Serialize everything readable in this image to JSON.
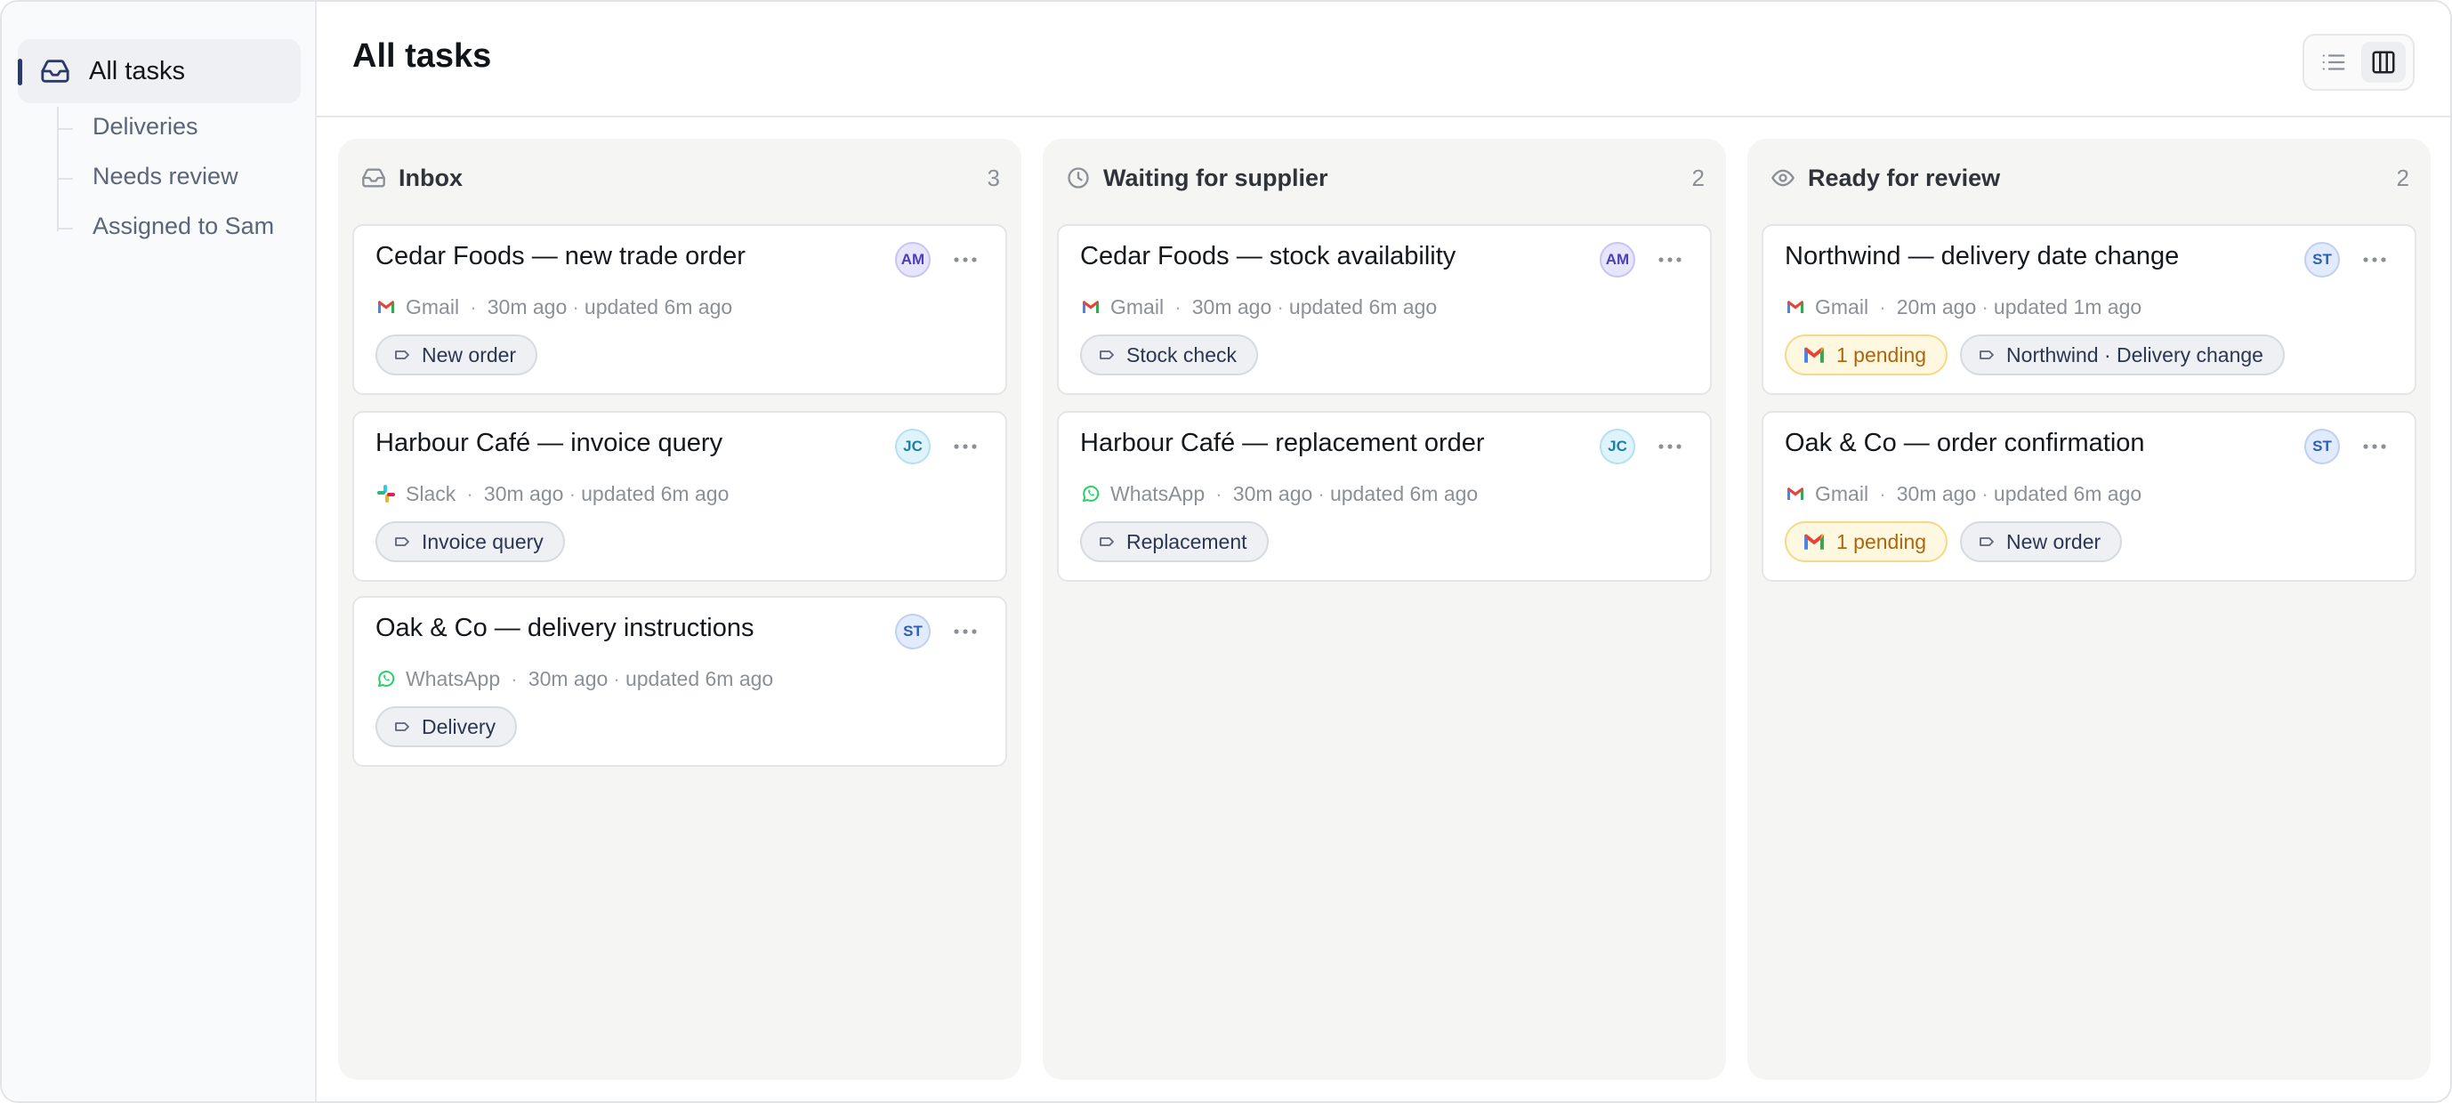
{
  "sidebar": {
    "active": {
      "label": "All tasks",
      "icon": "inbox-icon"
    },
    "sub_items": [
      {
        "label": "Deliveries"
      },
      {
        "label": "Needs review"
      },
      {
        "label": "Assigned to Sam"
      }
    ]
  },
  "header": {
    "title": "All tasks",
    "view_toggle": {
      "options": [
        "list-view-icon",
        "board-view-icon"
      ],
      "selected": "board-view-icon"
    }
  },
  "columns": [
    {
      "title": "Inbox",
      "count": "3",
      "icon": "inbox-icon",
      "cards": [
        {
          "title": "Cedar Foods — new trade order",
          "avatar": "AM",
          "source": "Gmail",
          "created": "30m ago",
          "updated": "updated 6m ago",
          "tags": [
            {
              "label": "New order"
            }
          ]
        },
        {
          "title": "Harbour Café — invoice query",
          "avatar": "JC",
          "source": "Slack",
          "created": "30m ago",
          "updated": "updated 6m ago",
          "tags": [
            {
              "label": "Invoice query"
            }
          ]
        },
        {
          "title": "Oak & Co — delivery instructions",
          "avatar": "ST",
          "source": "WhatsApp",
          "created": "30m ago",
          "updated": "updated 6m ago",
          "tags": [
            {
              "label": "Delivery"
            }
          ]
        }
      ]
    },
    {
      "title": "Waiting for supplier",
      "count": "2",
      "icon": "clock-icon",
      "cards": [
        {
          "title": "Cedar Foods — stock availability",
          "avatar": "AM",
          "source": "Gmail",
          "created": "30m ago",
          "updated": "updated 6m ago",
          "tags": [
            {
              "label": "Stock check"
            }
          ]
        },
        {
          "title": "Harbour Café — replacement order",
          "avatar": "JC",
          "source": "WhatsApp",
          "created": "30m ago",
          "updated": "updated 6m ago",
          "tags": [
            {
              "label": "Replacement"
            }
          ]
        }
      ]
    },
    {
      "title": "Ready for review",
      "count": "2",
      "icon": "eye-icon",
      "cards": [
        {
          "title": "Northwind — delivery date change",
          "avatar": "ST",
          "source": "Gmail",
          "created": "20m ago",
          "updated": "updated 1m ago",
          "pending": "1 pending",
          "tags": [
            {
              "label": "Northwind · Delivery change"
            }
          ]
        },
        {
          "title": "Oak & Co — order confirmation",
          "avatar": "ST",
          "source": "Gmail",
          "created": "30m ago",
          "updated": "updated 6m ago",
          "pending": "1 pending",
          "tags": [
            {
              "label": "New order"
            }
          ]
        }
      ]
    }
  ],
  "avatar_colors": {
    "AM": {
      "bg": "#e7e5fb",
      "border": "#c8c3f3",
      "fg": "#4b3fb6"
    },
    "JC": {
      "bg": "#dff3fb",
      "border": "#b4e0f2",
      "fg": "#1b7fa8"
    },
    "ST": {
      "bg": "#e2ebfb",
      "border": "#bfd0f2",
      "fg": "#2f5fb0"
    }
  },
  "colors": {
    "accent": "#2b3a67",
    "column_bg": "#f5f5f4",
    "pending_text": "#b0650a"
  }
}
